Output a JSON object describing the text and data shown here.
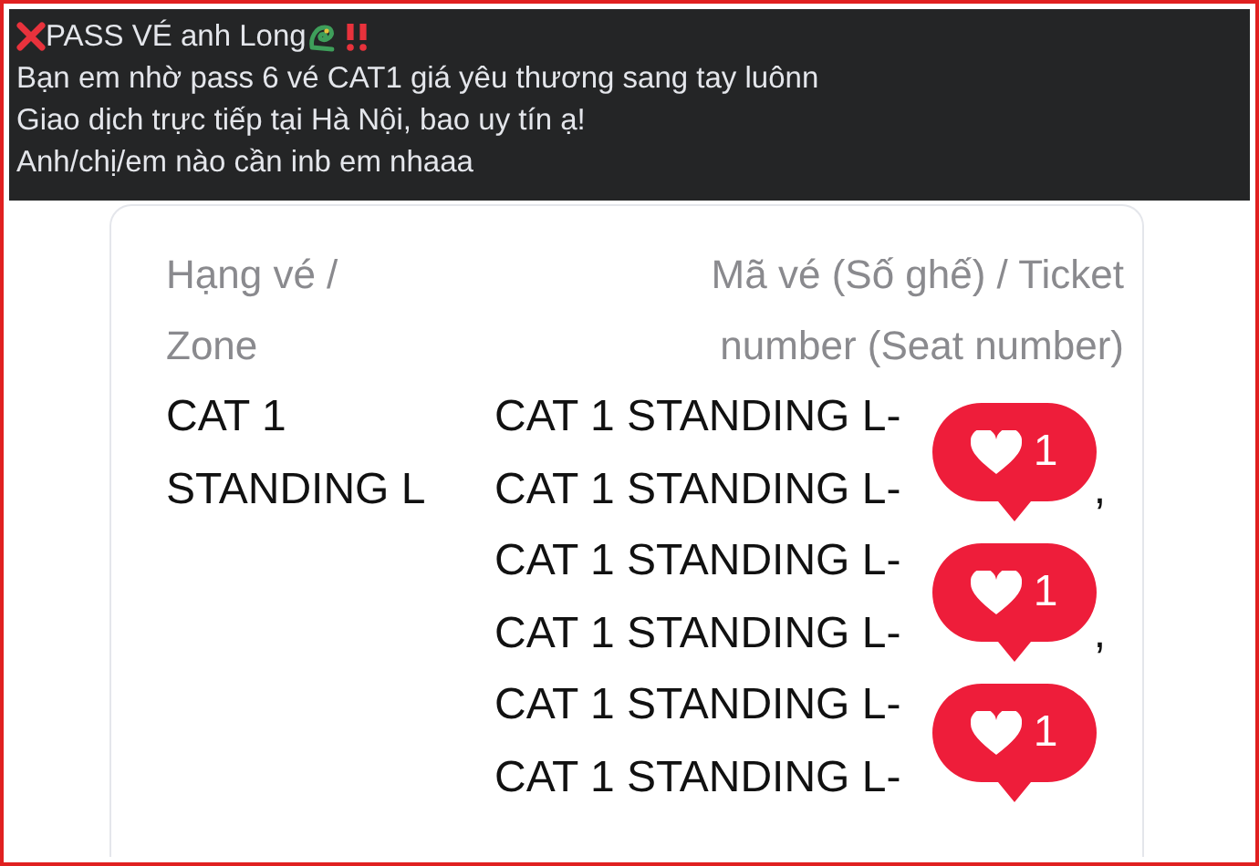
{
  "post": {
    "title": "PASS VÉ anh Long",
    "lines": [
      "Bạn em nhờ pass 6 vé CAT1 giá yêu thương sang tay luônn",
      "Giao dịch trực tiếp tại Hà Nội, bao uy tín ạ!",
      "Anh/chị/em nào cần inb em nhaaa"
    ]
  },
  "ticket": {
    "zone_header": [
      "Hạng vé /",
      "Zone"
    ],
    "number_header": [
      "Mã vé (Số ghế) / Ticket",
      "number (Seat number)"
    ],
    "zone": [
      "CAT 1",
      "STANDING L"
    ],
    "seats": [
      {
        "text": "CAT 1 STANDING L-"
      },
      {
        "text": "CAT 1 STANDING L-",
        "suffix": ","
      },
      {
        "text": "CAT 1 STANDING L-"
      },
      {
        "text": "CAT 1 STANDING L-",
        "suffix": ","
      },
      {
        "text": "CAT 1 STANDING L-"
      },
      {
        "text": "CAT 1 STANDING L-"
      }
    ]
  },
  "reactions": [
    {
      "count": "1"
    },
    {
      "count": "1"
    },
    {
      "count": "1"
    }
  ]
}
